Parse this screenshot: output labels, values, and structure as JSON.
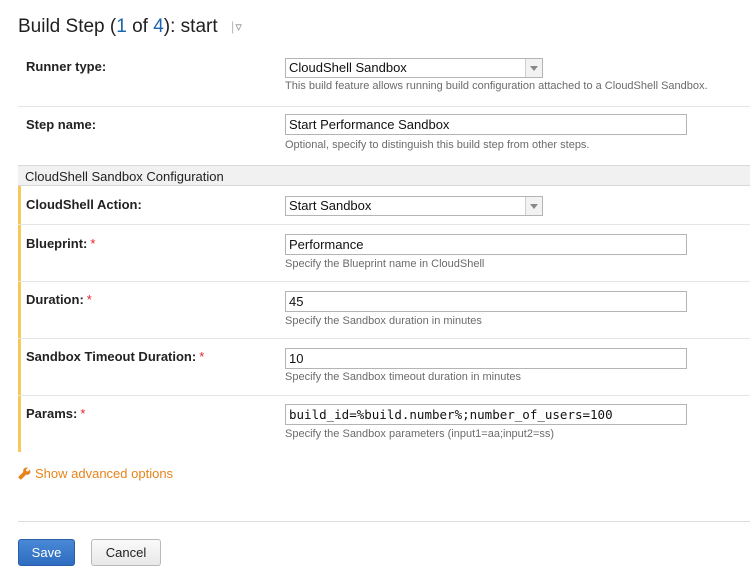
{
  "header": {
    "prefix": "Build Step (",
    "current": "1",
    "of": " of ",
    "total": "4",
    "suffix": "): start",
    "menu_sep": "|",
    "menu_icon": "▿"
  },
  "runner": {
    "label": "Runner type:",
    "value": "CloudShell Sandbox",
    "hint": "This build feature allows running build configuration attached to a CloudShell Sandbox."
  },
  "step_name": {
    "label": "Step name:",
    "value": "Start Performance Sandbox",
    "hint": "Optional, specify to distinguish this build step from other steps."
  },
  "section": {
    "title": "CloudShell Sandbox Configuration"
  },
  "action": {
    "label": "CloudShell Action:",
    "value": "Start Sandbox"
  },
  "blueprint": {
    "label": "Blueprint:",
    "required": "*",
    "value": "Performance",
    "hint": "Specify the Blueprint name in CloudShell"
  },
  "duration": {
    "label": "Duration:",
    "required": "*",
    "value": "45",
    "hint": "Specify the Sandbox duration in minutes"
  },
  "timeout": {
    "label": "Sandbox Timeout Duration:",
    "required": "*",
    "value": "10",
    "hint": "Specify the Sandbox timeout duration in minutes"
  },
  "params": {
    "label": "Params:",
    "required": "*",
    "value": "build_id=%build.number%;number_of_users=100",
    "hint": "Specify the Sandbox parameters (input1=aa;input2=ss)"
  },
  "advanced": {
    "label": "Show advanced options",
    "icon": "wrench-icon"
  },
  "buttons": {
    "save": "Save",
    "cancel": "Cancel"
  },
  "colors": {
    "accent": "#f9c85a",
    "link_orange": "#e8831c",
    "required_red": "#e0242b",
    "primary_blue": "#2d6cc0"
  }
}
